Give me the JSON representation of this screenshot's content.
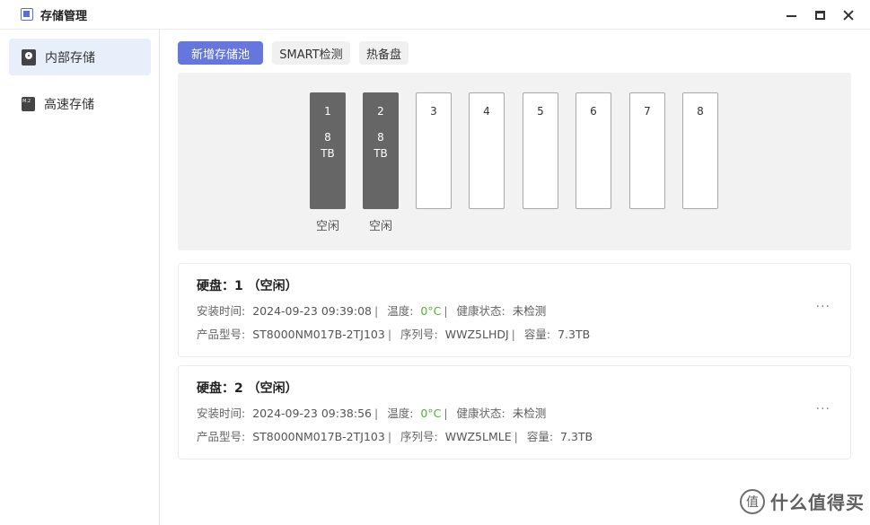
{
  "window": {
    "title": "存储管理"
  },
  "sidebar": {
    "items": [
      {
        "label": "内部存储",
        "icon": "hdd-icon",
        "active": true
      },
      {
        "label": "高速存储",
        "icon": "m2-ssd-icon",
        "active": false
      }
    ]
  },
  "toolbar": {
    "new_pool_label": "新增存储池",
    "smart_label": "SMART检测",
    "hot_spare_label": "热备盘"
  },
  "bays": [
    {
      "num": "1",
      "size": "8",
      "unit": "TB",
      "status": "空闲",
      "filled": true
    },
    {
      "num": "2",
      "size": "8",
      "unit": "TB",
      "status": "空闲",
      "filled": true
    },
    {
      "num": "3",
      "filled": false
    },
    {
      "num": "4",
      "filled": false
    },
    {
      "num": "5",
      "filled": false
    },
    {
      "num": "6",
      "filled": false
    },
    {
      "num": "7",
      "filled": false
    },
    {
      "num": "8",
      "filled": false
    }
  ],
  "disks": [
    {
      "title": "硬盘：1 （空闲）",
      "install_time_label": "安装时间:",
      "install_time": "2024-09-23 09:39:08",
      "temp_label": "温度:",
      "temp": "0°C",
      "health_label": "健康状态:",
      "health": "未检测",
      "model_label": "产品型号:",
      "model": "ST8000NM017B-2TJ103",
      "serial_label": "序列号:",
      "serial": "WWZ5LHDJ",
      "capacity_label": "容量:",
      "capacity": "7.3TB",
      "more": "···"
    },
    {
      "title": "硬盘：2 （空闲）",
      "install_time_label": "安装时间:",
      "install_time": "2024-09-23 09:38:56",
      "temp_label": "温度:",
      "temp": "0°C",
      "health_label": "健康状态:",
      "health": "未检测",
      "model_label": "产品型号:",
      "model": "ST8000NM017B-2TJ103",
      "serial_label": "序列号:",
      "serial": "WWZ5LMLE",
      "capacity_label": "容量:",
      "capacity": "7.3TB",
      "more": "···"
    }
  ],
  "watermark": {
    "logo": "值",
    "text": "什么值得买"
  },
  "colors": {
    "accent": "#6577dc",
    "sidebar_active": "#e9eefb",
    "bay_filled": "#666666",
    "temp_ok": "#52b034"
  }
}
